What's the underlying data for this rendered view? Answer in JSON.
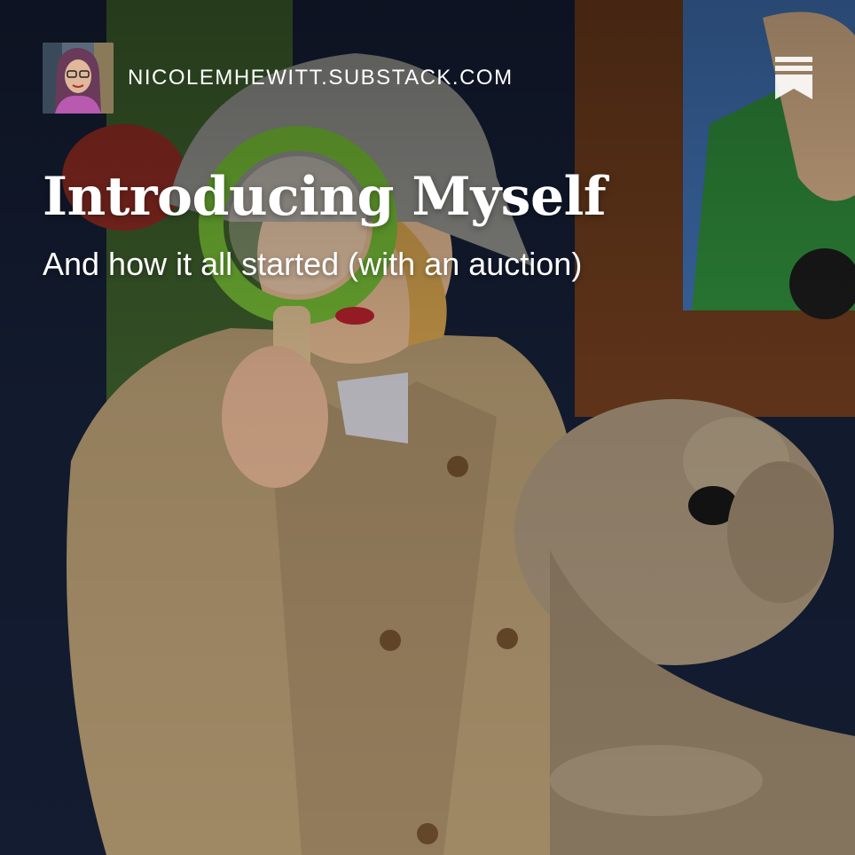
{
  "publication": {
    "domain": "NICOLEMHEWITT.SUBSTACK.COM",
    "avatar_icon": "author-avatar"
  },
  "post": {
    "title": "Introducing Myself",
    "subtitle": "And how it all started (with an auction)"
  },
  "icons": {
    "bookmark": "bookmark-icon"
  },
  "colors": {
    "text": "#ffffff",
    "background": "#111a2e"
  }
}
